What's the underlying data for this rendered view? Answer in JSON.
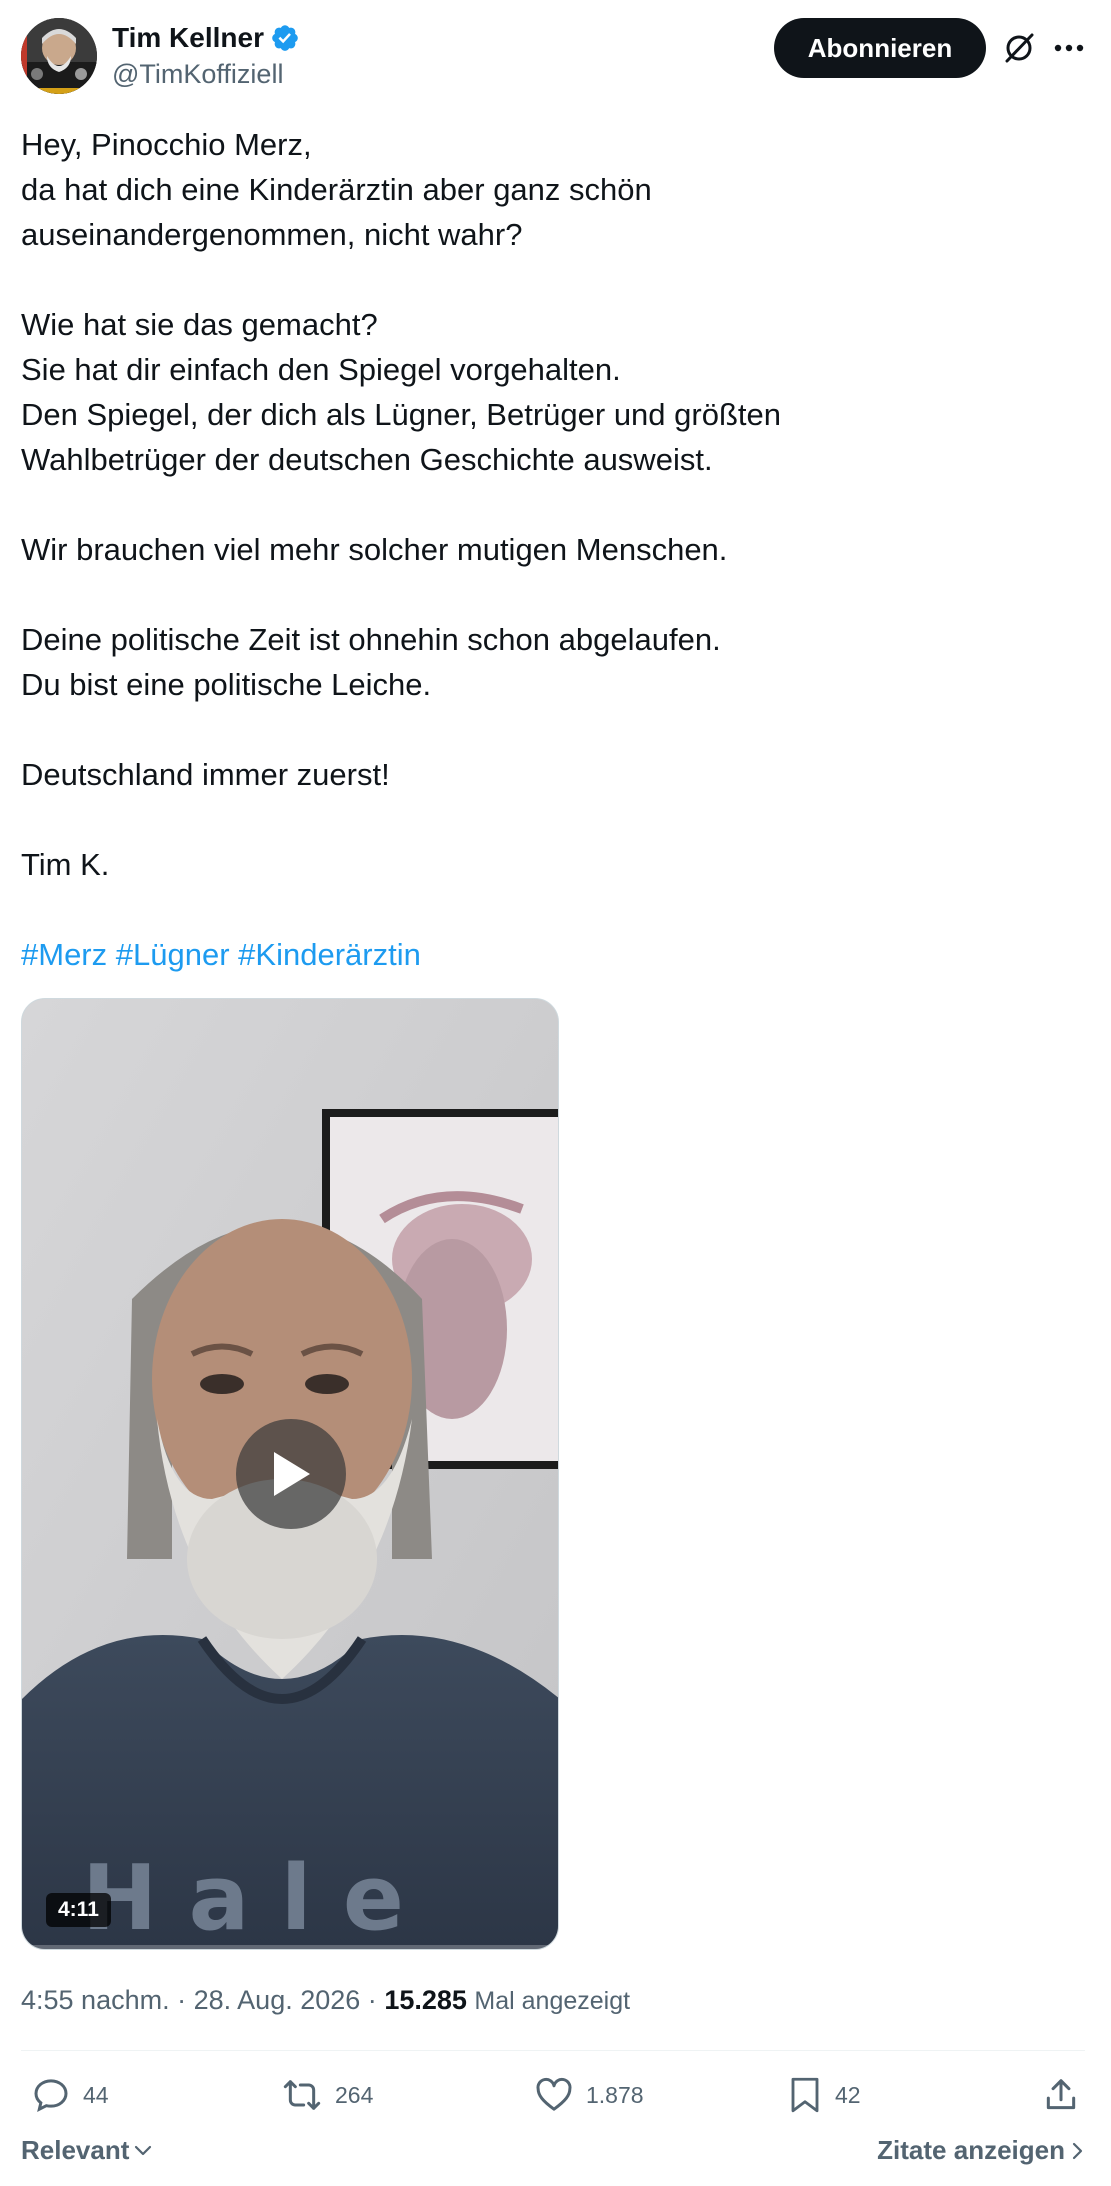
{
  "author": {
    "display_name": "Tim Kellner",
    "handle": "@TimKoffiziell",
    "verified": true,
    "avatar_icon": "profile-photo"
  },
  "header": {
    "subscribe_label": "Abonnieren",
    "grok_icon": "grok-icon",
    "more_icon": "more-dots-icon"
  },
  "tweet": {
    "lines": [
      "Hey, Pinocchio Merz,",
      "da hat dich eine Kinderärztin aber ganz schön",
      "auseinandergenommen, nicht wahr?",
      "",
      "Wie hat sie das gemacht?",
      "Sie hat dir einfach den Spiegel vorgehalten.",
      "Den Spiegel, der dich als Lügner, Betrüger und größten",
      "Wahlbetrüger der deutschen Geschichte ausweist.",
      "",
      "Wir brauchen viel mehr solcher mutigen Menschen.",
      "",
      "Deine politische Zeit ist ohnehin schon abgelaufen.",
      "Du bist eine politische Leiche.",
      "",
      "Deutschland immer zuerst!",
      "",
      "Tim K.",
      ""
    ],
    "hashtags": [
      "#Merz",
      "#Lügner",
      "#Kinderärztin"
    ]
  },
  "video": {
    "duration": "4:11",
    "play_icon": "play-icon"
  },
  "meta": {
    "time": "4:55 nachm.",
    "separator": "·",
    "date": "28. Aug. 2026",
    "views_count": "15.285",
    "views_label": "Mal angezeigt"
  },
  "actions": {
    "replies": "44",
    "reposts": "264",
    "likes": "1.878",
    "bookmarks": "42"
  },
  "footer": {
    "sort_label": "Relevant",
    "quotes_label": "Zitate anzeigen"
  },
  "colors": {
    "text": "#0f1419",
    "secondary": "#536471",
    "link": "#1d9bf0",
    "button_bg": "#0f1419",
    "verified": "#1d9bf0"
  }
}
